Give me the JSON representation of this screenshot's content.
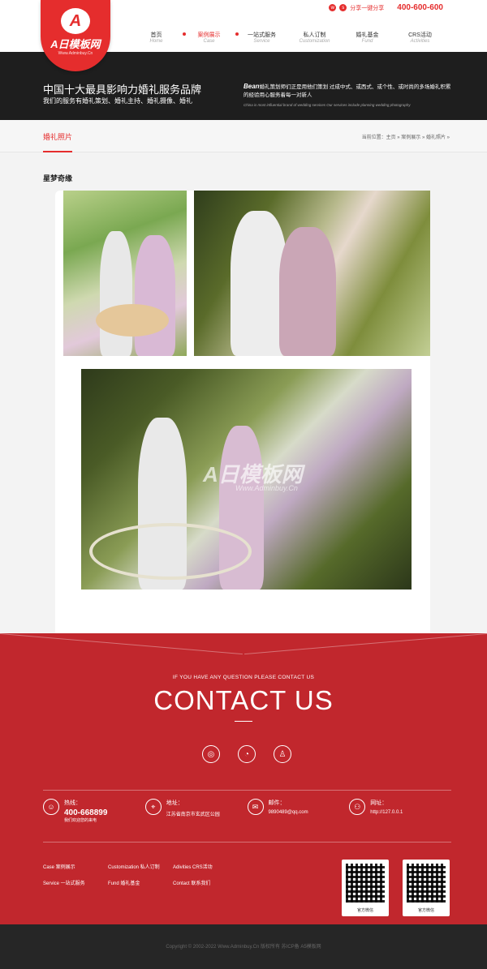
{
  "header": {
    "logo_text": "A日模板网",
    "logo_sub": "Www.Adminbuy.Cn",
    "share_label": "分享一键分享",
    "phone": "400-600-600",
    "nav": [
      {
        "cn": "首页",
        "en": "Home"
      },
      {
        "cn": "案例展示",
        "en": "Case"
      },
      {
        "cn": "一站式服务",
        "en": "Service"
      },
      {
        "cn": "私人订制",
        "en": "Customization"
      },
      {
        "cn": "婚礼基金",
        "en": "Fund"
      },
      {
        "cn": "CRS活动",
        "en": "Activities"
      }
    ]
  },
  "banner": {
    "title": "中国十大最具影响力婚礼服务品牌",
    "subtitle": "我们的服务有婚礼策划、婚礼主持、婚礼摄像、婚礼",
    "intro_brand": "Bean",
    "intro_text": "婚礼策划师们正是用他们策划 过成中式、或西式、或个性、或时尚的多场婚礼积累的经验用心服务着每一对新人",
    "intro_en": "China is most influential brand of wedding services Our services include planning wedding photography"
  },
  "crumb": {
    "title": "婚礼照片",
    "path": "当前位置：主页 » 案例展示 » 婚礼照片 »"
  },
  "main": {
    "case_title": "星梦奇缘",
    "watermark": "A日模板网",
    "watermark_sub": "Www.Adminbuy.Cn"
  },
  "contact": {
    "ask": "IF YOU HAVE ANY QUESTION PLEASE CONTACT US",
    "heading": "CONTACT US",
    "social": [
      "weibo-icon",
      "wechat-icon",
      "qq-icon"
    ],
    "phone_label": "热线：",
    "phone_value": "400-668899",
    "phone_note": "我们欢迎您的来电",
    "address_label": "地址：",
    "address_value": "江苏省南京市玄武区公园",
    "email_label": "邮件：",
    "email_value": "9890489@qq.com",
    "web_label": "网址：",
    "web_value": "http://127.0.0.1",
    "links": [
      [
        "Case  案例展示",
        "Customization  私人订制",
        "Adivities  CRS活动"
      ],
      [
        "Service  一站式服务",
        "Fund  婚礼基金",
        "Contact  联系我们"
      ]
    ],
    "qr1_caption": "官方微信",
    "qr2_caption": "官方微信"
  },
  "footer": {
    "copyright": "Copyright © 2002-2022 Www.Adminbuy.Cn 版权所有  苏ICP备  A5模板网"
  },
  "colors": {
    "brand_red": "#e52d2d",
    "contact_red": "#c1272d",
    "banner_dark": "#1e1e1e"
  }
}
